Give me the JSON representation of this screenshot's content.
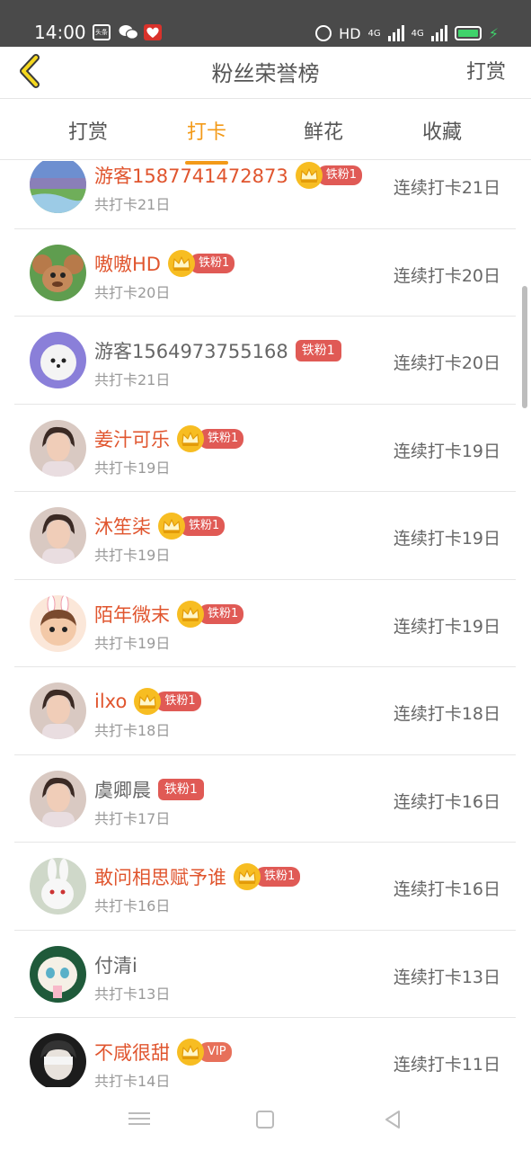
{
  "status_bar": {
    "time": "14:00",
    "apps": [
      "toutiao-icon",
      "wechat-icon",
      "app-icon"
    ],
    "toutiao_label": "头条",
    "hd_label": "HD",
    "net1": "4G",
    "net2": "4G"
  },
  "header": {
    "title": "粉丝荣誉榜",
    "action": "打赏"
  },
  "tabs": [
    {
      "label": "打赏",
      "active": false
    },
    {
      "label": "打卡",
      "active": true
    },
    {
      "label": "鲜花",
      "active": false
    },
    {
      "label": "收藏",
      "active": false
    }
  ],
  "colors": {
    "accent": "#f39a18",
    "highlight_name": "#e0552e",
    "badge": "#e05a55",
    "crown": "#f7bd22"
  },
  "users": [
    {
      "name": "游客1587741472873",
      "highlight": true,
      "crown": true,
      "badge": "铁粉1",
      "total": "共打卡21日",
      "streak": "连续打卡21日",
      "avatar": "landscape"
    },
    {
      "name": "嗷嗷HD",
      "highlight": true,
      "crown": true,
      "badge": "铁粉1",
      "total": "共打卡20日",
      "streak": "连续打卡20日",
      "avatar": "cartoon-mouse"
    },
    {
      "name": "游客1564973755168",
      "highlight": false,
      "crown": false,
      "badge": "铁粉1",
      "total": "共打卡21日",
      "streak": "连续打卡20日",
      "avatar": "white-dog"
    },
    {
      "name": "姜汁可乐",
      "highlight": true,
      "crown": true,
      "badge": "铁粉1",
      "total": "共打卡19日",
      "streak": "连续打卡19日",
      "avatar": "portrait"
    },
    {
      "name": "沐笙柒",
      "highlight": true,
      "crown": true,
      "badge": "铁粉1",
      "total": "共打卡19日",
      "streak": "连续打卡19日",
      "avatar": "portrait"
    },
    {
      "name": "陌年微末",
      "highlight": true,
      "crown": true,
      "badge": "铁粉1",
      "total": "共打卡19日",
      "streak": "连续打卡19日",
      "avatar": "cartoon-bunny"
    },
    {
      "name": "ilxo",
      "highlight": true,
      "crown": true,
      "badge": "铁粉1",
      "total": "共打卡18日",
      "streak": "连续打卡18日",
      "avatar": "portrait"
    },
    {
      "name": "虞卿晨",
      "highlight": false,
      "crown": false,
      "badge": "铁粉1",
      "total": "共打卡17日",
      "streak": "连续打卡16日",
      "avatar": "portrait"
    },
    {
      "name": "敢问相思赋予谁",
      "highlight": true,
      "crown": true,
      "badge": "铁粉1",
      "total": "共打卡16日",
      "streak": "连续打卡16日",
      "avatar": "rabbit"
    },
    {
      "name": "付清i",
      "highlight": false,
      "crown": false,
      "badge": "",
      "total": "共打卡13日",
      "streak": "连续打卡13日",
      "avatar": "cartoon-face"
    },
    {
      "name": "不咸很甜",
      "highlight": true,
      "crown": true,
      "badge": "VIP",
      "total": "共打卡14日",
      "streak": "连续打卡11日",
      "avatar": "portrait-dark"
    }
  ],
  "nav_bar": [
    "menu-icon",
    "home-icon",
    "back-icon"
  ]
}
